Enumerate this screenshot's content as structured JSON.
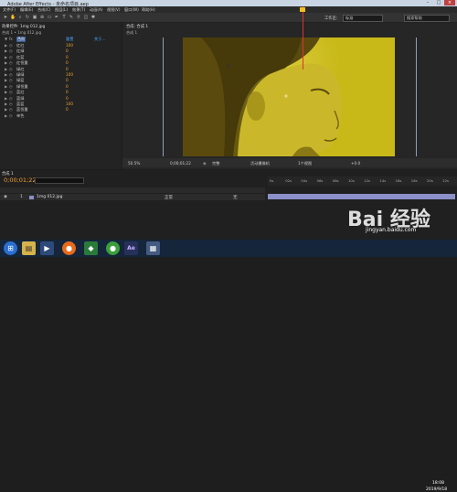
{
  "app": {
    "title": "Adobe After Effects - 未命名项目.aep",
    "window_controls": [
      "–",
      "□",
      "×"
    ]
  },
  "menu": [
    "文件(F)",
    "编辑(E)",
    "合成(C)",
    "图层(L)",
    "效果(T)",
    "动画(A)",
    "视图(V)",
    "窗口(W)",
    "帮助(H)"
  ],
  "toolbar": {
    "workspace_label": "工作区:",
    "workspace_value": "标准",
    "search_placeholder": "搜索帮助"
  },
  "effects_panel": {
    "tab": "效果控件: 1mg 012.jpg",
    "subtitle": "合成 1 • 1mg 012.jpg",
    "header": {
      "name": "色阶",
      "value": "重置",
      "about": "关于..."
    },
    "rows": [
      {
        "name": "红红",
        "value": "100"
      },
      {
        "name": "红绿",
        "value": "0"
      },
      {
        "name": "红蓝",
        "value": "0"
      },
      {
        "name": "红恒量",
        "value": "0"
      },
      {
        "name": "绿红",
        "value": "0"
      },
      {
        "name": "绿绿",
        "value": "100"
      },
      {
        "name": "绿蓝",
        "value": "0"
      },
      {
        "name": "绿恒量",
        "value": "0"
      },
      {
        "name": "蓝红",
        "value": "0"
      },
      {
        "name": "蓝绿",
        "value": "0"
      },
      {
        "name": "蓝蓝",
        "value": "100"
      },
      {
        "name": "蓝恒量",
        "value": "0"
      },
      {
        "name": "单色",
        "value": ""
      }
    ]
  },
  "comp_panel": {
    "tab": "合成: 合成 1",
    "subtitle": "合成 1",
    "viewer_bar": [
      "50.5%",
      "0;00;01;22",
      "完整",
      "活动摄像机",
      "1个视图",
      "+0.0"
    ]
  },
  "timeline": {
    "tab": "合成 1",
    "time": "0;00;01;22",
    "layer_name": "1mg 012.jpg",
    "layer_index": "1",
    "mode": "正常",
    "parent": "无",
    "ruler_ticks": [
      "0s",
      "02s",
      "04s",
      "06s",
      "08s",
      "10s",
      "12s",
      "14s",
      "16s",
      "18s",
      "20s",
      "22s"
    ]
  },
  "taskbar": {
    "items": [
      "start-icon",
      "folder-icon",
      "media-icon",
      "firefox-icon",
      "app-icon",
      "green-icon",
      "ae-icon",
      "window-icon"
    ],
    "time": "18:08",
    "date": "2019/9/18"
  },
  "watermark": {
    "text": "Bai 经验",
    "url": "jingyan.baidu.com"
  }
}
